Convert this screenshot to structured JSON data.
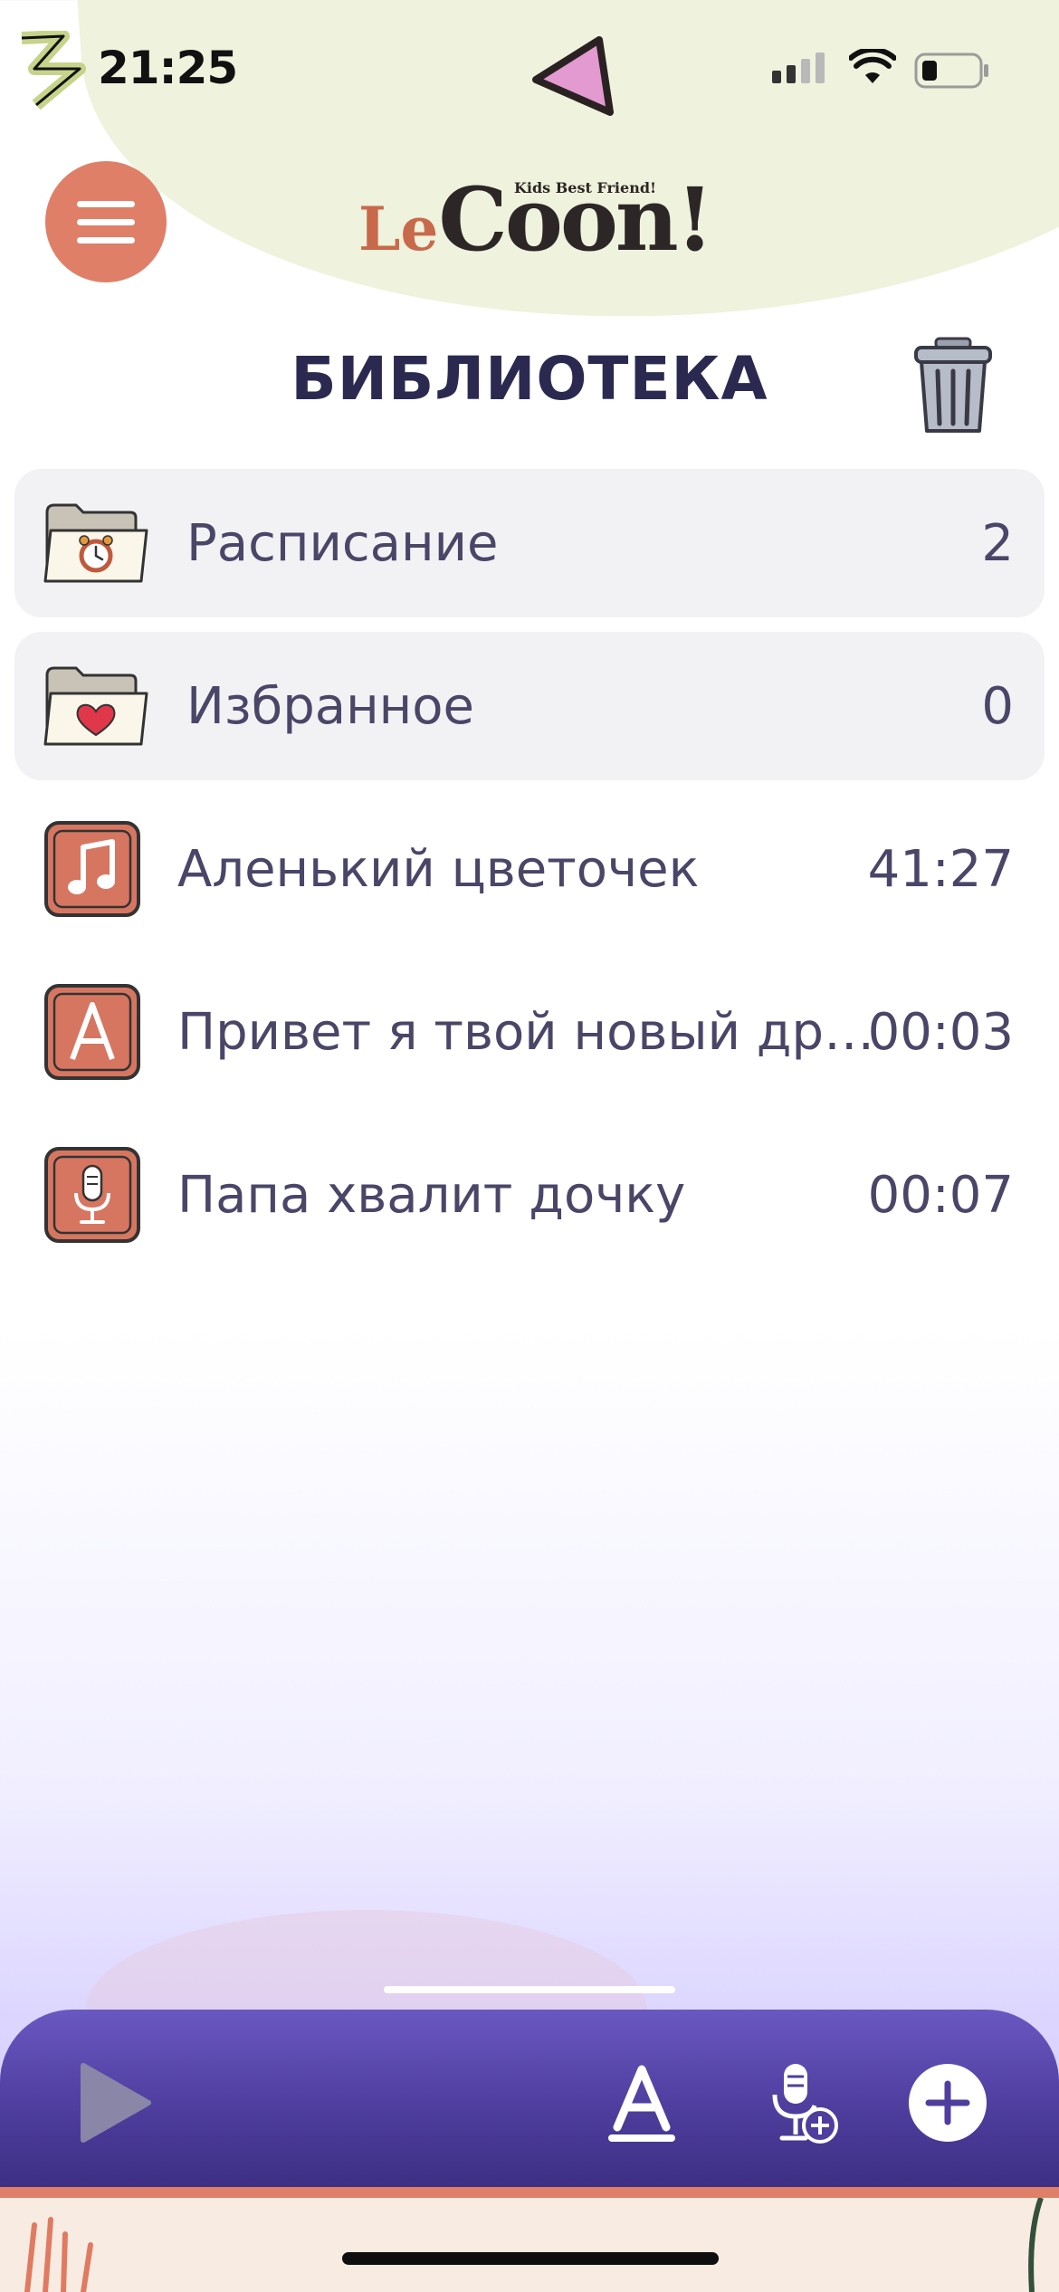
{
  "status_bar": {
    "time": "21:25"
  },
  "header": {
    "logo_prefix": "Le",
    "logo_main": "Coon!",
    "logo_tagline": "Kids Best Friend!"
  },
  "page": {
    "title": "БИБЛИОТЕКА"
  },
  "folders": [
    {
      "label": "Расписание",
      "count": "2",
      "icon": "alarm-clock-folder-icon"
    },
    {
      "label": "Избранное",
      "count": "0",
      "icon": "heart-folder-icon"
    }
  ],
  "items": [
    {
      "label": "Аленький цветочек",
      "duration": "41:27",
      "icon": "music-note-icon"
    },
    {
      "label": "Привет я твой новый дру…",
      "duration": "00:03",
      "icon": "text-letter-icon"
    },
    {
      "label": "Папа хвалит дочку",
      "duration": "00:07",
      "icon": "microphone-icon"
    }
  ],
  "colors": {
    "accent": "#df7f68",
    "title": "#2c2951",
    "bar": "#5a48b0",
    "folder_bg": "#f2f2f5",
    "header_blob": "#eff2dc"
  }
}
